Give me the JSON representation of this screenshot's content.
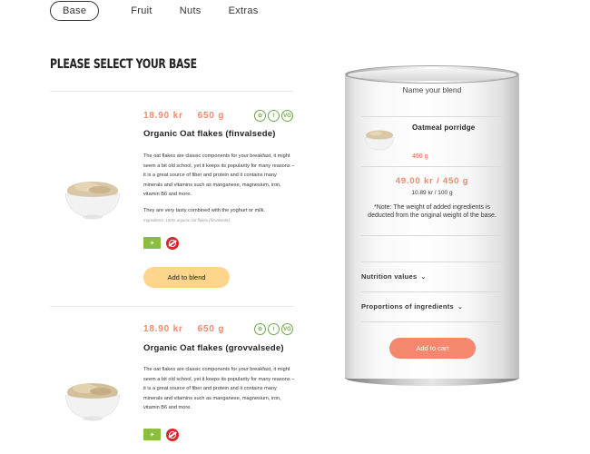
{
  "tabs": [
    {
      "label": "Base",
      "active": true
    },
    {
      "label": "Fruit",
      "active": false
    },
    {
      "label": "Nuts",
      "active": false
    },
    {
      "label": "Extras",
      "active": false
    }
  ],
  "page_title": "PLEASE SELECT YOUR BASE",
  "products": [
    {
      "price": "18.90 kr",
      "weight": "650 g",
      "badges": [
        "leaf-icon",
        "wheat-icon",
        "vegan-icon"
      ],
      "badge_marks": [
        "✿",
        "⌇",
        "VG"
      ],
      "name": "Organic Oat flakes (finvalsede)",
      "description": "The oat flakes are classic components for your breakfast, it might seem a bit old school, yet it keeps its popularity for many reasons – it is a great source of fiber and protein and it contains many minerals and vitamins such as manganese, magnesium, iron, vitamin B6 and more.",
      "description_2": "They are very tasty combined with the yoghurt or milk.",
      "ingredients": "Ingredients: 100% organic oat flakes (finvalsede)",
      "add_label": "Add to blend"
    },
    {
      "price": "18.90 kr",
      "weight": "650 g",
      "badges": [
        "leaf-icon",
        "wheat-icon",
        "vegan-icon"
      ],
      "badge_marks": [
        "✿",
        "⌇",
        "VG"
      ],
      "name": "Organic Oat flakes (grovvalsede)",
      "description": "The oat flakes are classic components for your breakfast, it might seem a bit old school, yet it keeps its popularity for many reasons – it is a great source of fiber and protein and it contains many minerals and vitamins such as manganese, magnesium, iron, vitamin B6 and more."
    }
  ],
  "can": {
    "blend_name_placeholder": "Name your blend",
    "item_name": "Oatmeal porridge",
    "item_price": "450 g",
    "total": "49.00 kr / 450 g",
    "per100": "10.89 kr / 100 g",
    "note": "*Note: The weight of added ingredients is deducted from the original weight of the base.",
    "nutrition_label": "Nutrition values",
    "proportions_label": "Proportions of ingredients",
    "chevron": "⌄",
    "cart_label": "Add to cart"
  },
  "colors": {
    "accent": "#f08a6c",
    "add_button": "#fdd58d",
    "cart_button": "#f4876e",
    "organic_green": "#8bbd3f",
    "oe_red": "#d7262a"
  }
}
